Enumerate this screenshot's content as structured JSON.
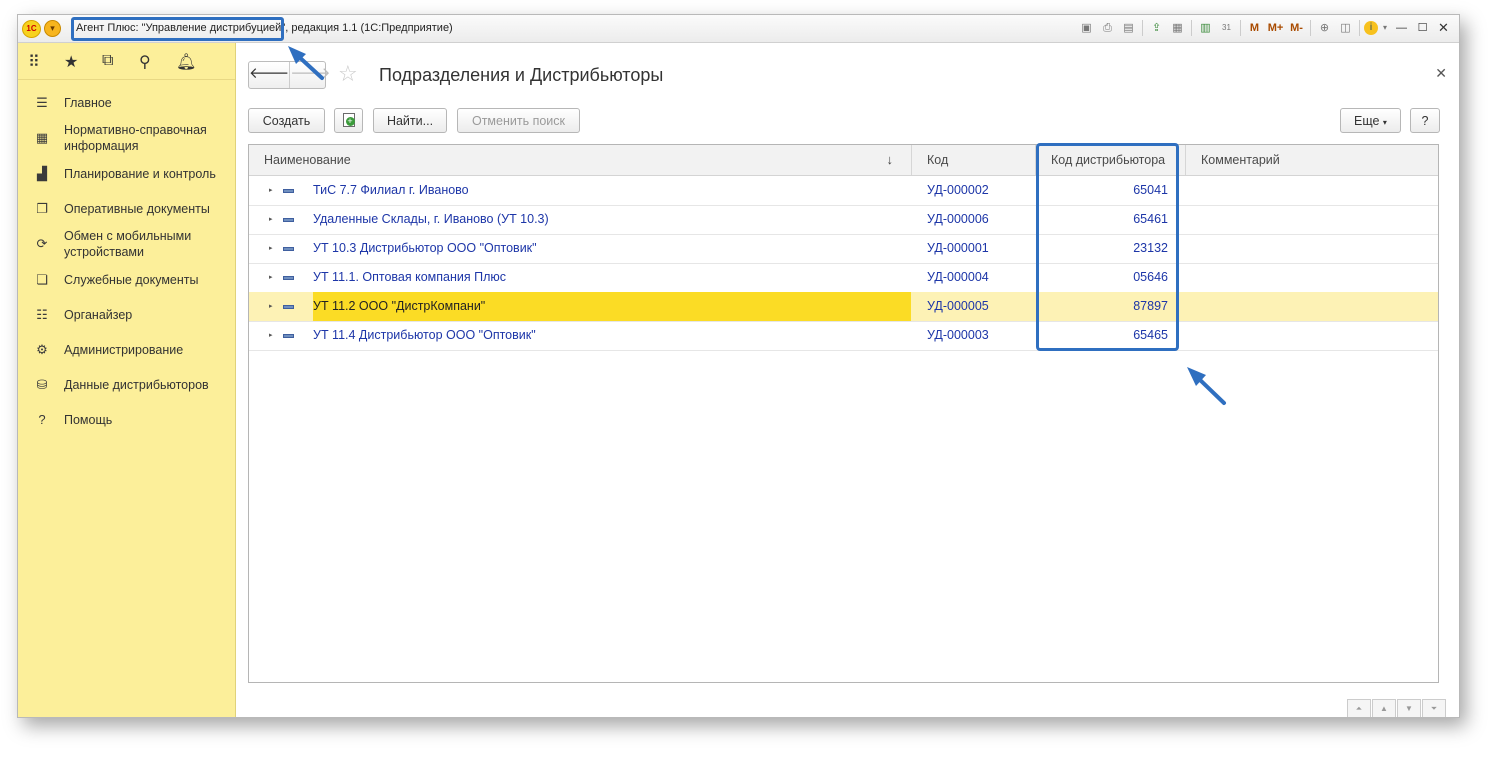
{
  "window": {
    "title": "Агент Плюс: \"Управление дистрибуцией\", редакция 1.1  (1С:Предприятие)",
    "logo_text": "1С",
    "toolbar_icons": [
      "save-icon",
      "print-icon",
      "preview-icon",
      "upload-icon",
      "document-icon",
      "calculator-icon",
      "calendar-icon",
      "m-icon",
      "m-plus-icon",
      "m-minus-icon",
      "zoom-icon",
      "panel-icon",
      "info-icon",
      "minimize-icon",
      "maximize-icon",
      "close-icon"
    ],
    "memory_labels": {
      "m": "M",
      "m_plus": "M+",
      "m_minus": "M-"
    },
    "calendar_day": "31"
  },
  "sidebar": {
    "top_icons": [
      "apps-grid-icon",
      "favorites-star-icon",
      "history-icon",
      "search-icon",
      "notifications-bell-icon"
    ],
    "items": [
      {
        "label": "Главное",
        "icon": "menu-lines-icon"
      },
      {
        "label": "Нормативно-справочная информация",
        "icon": "grid-icon"
      },
      {
        "label": "Планирование и контроль",
        "icon": "bar-chart-icon"
      },
      {
        "label": "Оперативные документы",
        "icon": "documents-icon"
      },
      {
        "label": "Обмен с мобильными устройствами",
        "icon": "sync-icon"
      },
      {
        "label": "Служебные документы",
        "icon": "service-docs-icon"
      },
      {
        "label": "Органайзер",
        "icon": "checklist-icon"
      },
      {
        "label": "Администрирование",
        "icon": "gear-icon"
      },
      {
        "label": "Данные дистрибьюторов",
        "icon": "distributor-data-icon"
      },
      {
        "label": "Помощь",
        "icon": "help-icon"
      }
    ]
  },
  "form": {
    "title": "Подразделения и Дистрибьюторы",
    "buttons": {
      "create": "Создать",
      "find": "Найти...",
      "cancel_search": "Отменить поиск",
      "more": "Еще",
      "help": "?"
    }
  },
  "table": {
    "columns": [
      "Наименование",
      "Код",
      "Код дистрибьютора",
      "Комментарий"
    ],
    "sort_indicator": "↓",
    "rows": [
      {
        "name": "ТиС 7.7 Филиал г. Иваново",
        "code": "УД-000002",
        "dist_code": "65041",
        "comment": "",
        "selected": false
      },
      {
        "name": "Удаленные Склады, г. Иваново (УТ 10.3)",
        "code": "УД-000006",
        "dist_code": "65461",
        "comment": "",
        "selected": false
      },
      {
        "name": "УТ 10.3 Дистрибьютор ООО \"Оптовик\"",
        "code": "УД-000001",
        "dist_code": "23132",
        "comment": "",
        "selected": false
      },
      {
        "name": "УТ 11.1. Оптовая компания Плюс",
        "code": "УД-000004",
        "dist_code": "05646",
        "comment": "",
        "selected": false
      },
      {
        "name": "УТ 11.2 ООО \"ДистрКомпани\"",
        "code": "УД-000005",
        "dist_code": "87897",
        "comment": "",
        "selected": true
      },
      {
        "name": "УТ 11.4 Дистрибьютор ООО \"Оптовик\"",
        "code": "УД-000003",
        "dist_code": "65465",
        "comment": "",
        "selected": false
      }
    ]
  },
  "colors": {
    "sidebar_bg": "#fcef9a",
    "selected_row": "#fbdc25",
    "link_text": "#1d36a8",
    "annotation": "#2f6fc0"
  }
}
